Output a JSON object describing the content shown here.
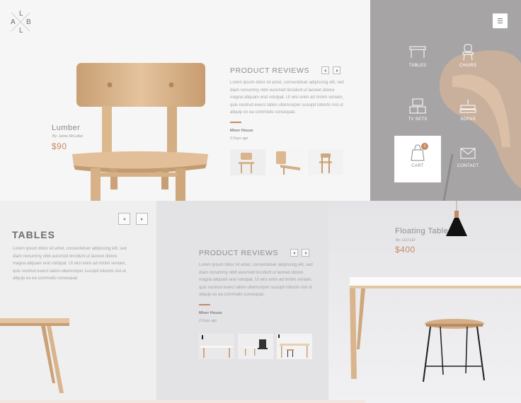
{
  "brand": {
    "letters": [
      "L",
      "A",
      "B",
      "L"
    ]
  },
  "hero": {
    "product_name": "Lumber",
    "product_by": "By: Jamie McLellan",
    "product_price": "$90"
  },
  "reviews": {
    "title": "PRODUCT REVIEWS",
    "text": "Lorem ipsum dolor sit amet, consectetuer adipiscing elit, sed diam nonummy nibh euismod tincidunt ut laoreet dolore magna aliquam erat volutpat. Ut wisi enim ad minim veniam, quis nostrud exerci tation ullamcorper suscipit lobortis nisl ut aliquip ex ea commodo consequat.",
    "author": "Mixer House",
    "date": "2 Days ago"
  },
  "menu": {
    "items": [
      {
        "label": "TABLES",
        "icon": "table-icon"
      },
      {
        "label": "CHAIRS",
        "icon": "chair-icon"
      },
      {
        "label": "TV SETS",
        "icon": "tv-set-icon"
      },
      {
        "label": "SOFAS",
        "icon": "sofa-icon"
      },
      {
        "label": "CART",
        "icon": "shopping-bag-icon",
        "badge": "1"
      },
      {
        "label": "CONTACT",
        "icon": "envelope-icon"
      }
    ]
  },
  "tables": {
    "heading": "TABLES",
    "text": "Lorem ipsum dolor sit amet, consectetuer adipiscing elit, sed diam nonummy nibh euismod tincidunt ut laoreet dolore magna aliquam erat volutpat. Ut wisi enim ad minim veniam, quis nostrud exerci tation ullamcorper suscipit lobortis nisl ut aliquip ex ea commodo consequat."
  },
  "reviews2": {
    "title": "PRODUCT REVIEWS",
    "text": "Lorem ipsum dolor sit amet, consectetuer adipiscing elit, sed diam nonummy nibh euismod tincidunt ut laoreet dolore magna aliquam erat volutpat. Ut wisi enim ad minim veniam, quis nostrud exerci tation ullamcorper suscipit lobortis nisl ut aliquip ex ea commodo consequat.",
    "author": "Mixer House",
    "date": "2 Days ago"
  },
  "floating": {
    "product_name": "Floating Table",
    "product_by": "By: LEO LEI",
    "product_price": "$400"
  },
  "colors": {
    "accent": "#c58a64",
    "menu_bg": "#a7a4a5",
    "wood": "#d9b48d"
  }
}
